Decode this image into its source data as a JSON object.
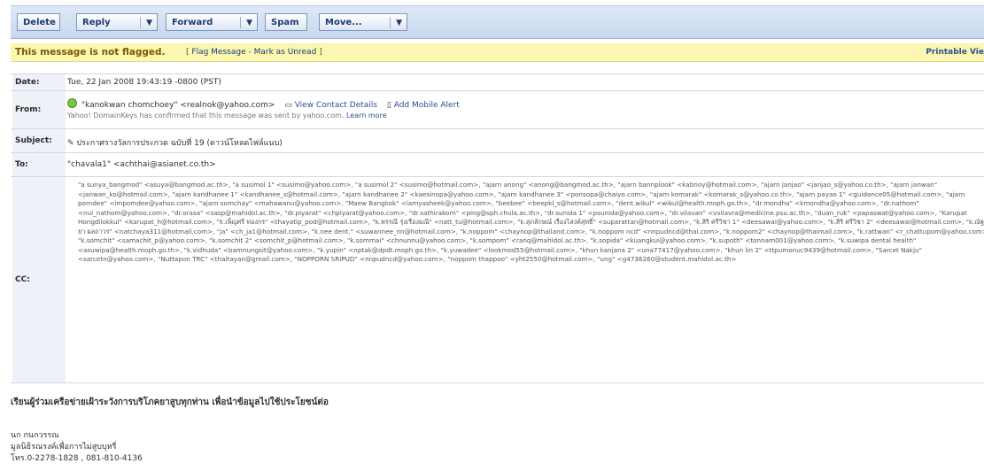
{
  "toolbar": {
    "delete": "Delete",
    "reply": "Reply",
    "forward": "Forward",
    "spam": "Spam",
    "move": "Move..."
  },
  "flag": {
    "message": "This message is not flagged.",
    "links_open": "[",
    "flag_link": "Flag Message",
    "dash": "-",
    "unread_link": "Mark as Unread",
    "links_close": "]",
    "printable": "Printable Vie"
  },
  "header": {
    "date_label": "Date:",
    "date_value": "Tue, 22 Jan 2008 19:43:19 -0800 (PST)",
    "from_label": "From:",
    "from_value": "\"kanokwan chomchoey\" <realnok@yahoo.com>",
    "view_contact": "View Contact Details",
    "add_mobile": "Add Mobile Alert",
    "domainkeys": "Yahoo! DomainKeys has confirmed that this message was sent by yahoo.com.",
    "learn_more": "Learn more",
    "subject_label": "Subject:",
    "subject_value": "ประกาศรางวัลการประกวด ฉบับที่ 19 (ดาวน์โหลดไฟล์แนบ)",
    "to_label": "To:",
    "to_value": "\"chavala1\" <achthai@asianet.co.th>",
    "cc_label": "CC:",
    "cc_value": "\"a sunya_bangmod\" <asuya@bangmod.ac.th>, \"a susimol 1\" <susimo@yahoo.com>, \"a susimol 2\" <susimo@hotmail.com>, \"ajarn anong\" <anong@bangmod.ac.th>, \"ajarn bannplook\" <kabnoy@hotmail.com>, \"ajarn janjao\" <janjao_s@yahoo.co.th>, \"ajarn janwan\" <janwan_ko@hotmail.com>, \"ajarn kandhanee 1\" <kandhanee_s@hotmail.com>, \"ajarn kandhanee 2\" <kaesinopa@yahoo.com>, \"ajarn kandhanee 3\" <ponsopa@chaiyo.com>, \"ajarn komarak\" <komarak_s@yahoo.co.th>, \"ajarn payao 1\" <guidance05@hotmail.com>, \"ajarn porndee\" <impomdee@yahoo.com>, \"ajarn somchay\" <mahawanu@yahoo.com>, \"Maew Bangkok\" <iamyasheek@yahoo.com>, \"beebee\" <beepkl_s@hotmail.com>, \"dent.wikul\" <wikul@health.moph.go.th>, \"dr.mondha\" <kmondha@yahoo.com>, \"dr.nathom\" <nui_nathom@yahoo.com>, \"dr.orasa\" <sasp@mahidol.ac.th>, \"dr.piyarat\" <chpiyarat@yahoo.com>, \"dr.sathirakorn\" <ping@sph.chula.ac.th>, \"dr.sunida 1\" <psunida@yahoo.com>, \"dr.vilavan\" <vvilavra@medicine.psu.ac.th>, \"duan_ruk\" <papaswat@yahoo.com>, \"Karupat Hongdilokkul\" <karupat_h@hotmail.com>, \"k.เพ็ญศรี ทองกร\" <thayatip_pod@hotmail.com>, \"k.พรรณี รุ่งเรืองมณี\" <natt_tu@hotmail.com>, \"k.สุภลักษณ์ เรืองไสงค์สุทธิ์\" <suparattan@hotmail.com>, \"k.สิริ ศรีวิชา 1\" <deesawai@yahoo.com>, \"k.สิริ ศรีวิชา 2\" <deesawai@hotmail.com>, \"k.ณัฐยา ผลถาวร\" <natchaya311@hotmail.com>, \"ja\" <ch_ja1@hotmail.com>, \"k.nee dent.\" <suwannee_nn@hotmail.com>, \"k.noppom\" <chaynop@thailand.com>, \"k.noppom ncd\" <nnpudncd@thai.com>, \"k.noppom2\" <chaynop@thaimail.com>, \"k.rattwan\" <r_chattupom@yahoo.com>, \"k.somchit\" <samachit_p@yahoo.com>, \"k.somchit 2\" <somchit_p@hotmail.com>, \"k.sommai\" <chnunnu@yahoo.com>, \"k.sompom\" <ranq@mahidol.ac.th>, \"k.sopida\" <kuangkui@yahoo.com>, \"k.supoth\" <tonnam001@yahoo.com>, \"k.suwipa dental health\" <asuwipa@health.moph.go.th>, \"k.vidhuda\" <bamnungsit@yahoo.com>, \"k.yupin\" <nptak@dpdt.moph.go.th>, \"k.yuwadee\" <lookmod55@hotmail.com>, \"khun kanjana 2\" <una77417@yahoo.com>, \"khun lin 2\" <ttpumonuc9439@hotmail.com>, \"Sarcet Nakju\" <sarcetn@yahoo.com>, \"Nuttapon TRC\" <thaitayan@gmail.com>, \"NOPPORN SRIPUD\" <nnpudncd@yahoo.com>, \"noppom thappoo\" <yht2550@hotmail.com>, \"ung\" <g4736260@student.mahidol.ac.th>"
  },
  "message": {
    "line1": "เรียนผู้ร่วมเครือข่ายเฝ้าระวังการบริโภคยาสูบทุกท่าน เพื่อนำข้อมูลไปใช้ประโยชน์ต่อ",
    "sig_name": "นก กนกวรรณ",
    "sig_org": "มูลนิธิรณรงค์เพื่อการไม่สูบบุหรี่",
    "sig_phone": "โทร.0-2278-1828 , 081-810-4136"
  }
}
